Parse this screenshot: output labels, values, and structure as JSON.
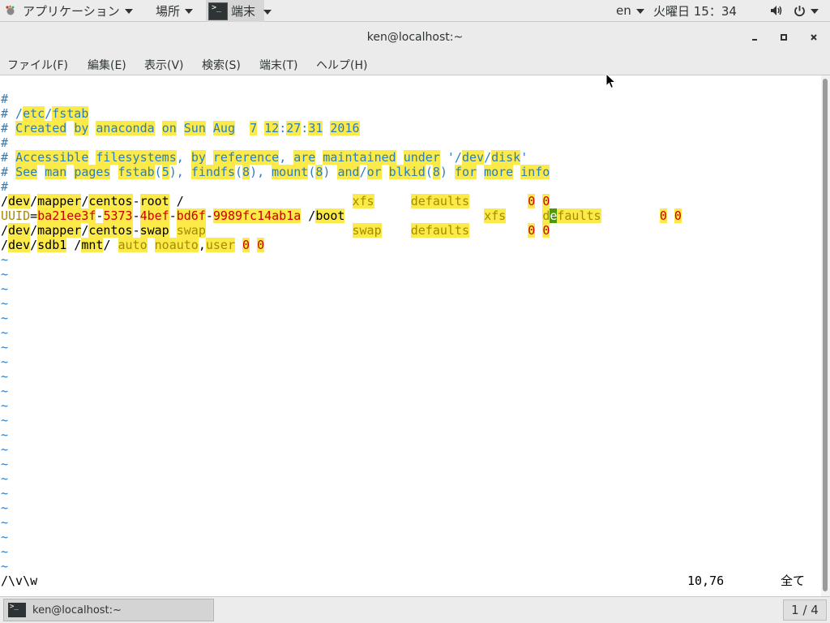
{
  "top_panel": {
    "applications_label": "アプリケーション",
    "places_label": "場所",
    "terminal_label": "端末",
    "language": "en",
    "clock": "火曜日 15：34"
  },
  "window": {
    "title": "ken@localhost:~"
  },
  "menubar": {
    "items": [
      "ファイル(F)",
      "編集(E)",
      "表示(V)",
      "検索(S)",
      "端末(T)",
      "ヘルプ(H)"
    ]
  },
  "terminal": {
    "status_command": "/\\v\\w",
    "status_position": "10,76",
    "status_scroll": "全て",
    "tilde": "~"
  },
  "taskbar": {
    "task_label": "ken@localhost:~",
    "workspace": "1 / 4"
  },
  "colors": {
    "highlight": "#fcea48",
    "vim_blue": "#2c7dbf",
    "vim_olive": "#a48b00",
    "vim_red": "#cc0000",
    "cursor": "#4e9a06"
  }
}
